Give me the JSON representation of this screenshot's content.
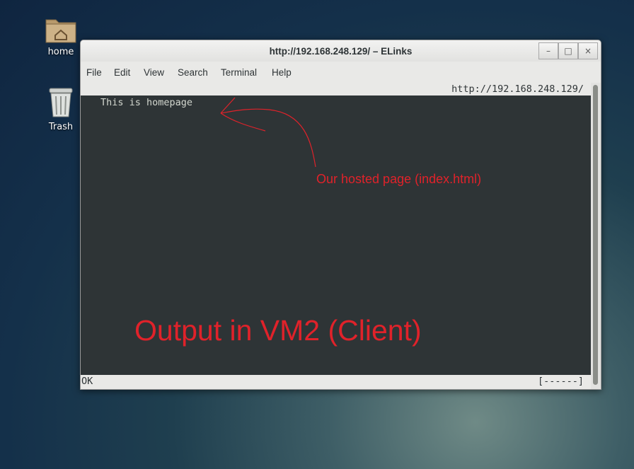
{
  "desktop": {
    "icons": [
      {
        "label": "home"
      },
      {
        "label": "Trash"
      }
    ]
  },
  "window": {
    "title": "http://192.168.248.129/ – ELinks",
    "controls": {
      "minimize": "–",
      "maximize": "□",
      "close": "×"
    },
    "menu": [
      "File",
      "Edit",
      "View",
      "Search",
      "Terminal",
      "Help"
    ]
  },
  "elinks": {
    "url": "http://192.168.248.129/",
    "page_text": "This is homepage",
    "status_left": "OK",
    "status_right": "[------]"
  },
  "annotations": {
    "pointer_note": "Our hosted page (index.html)",
    "caption": "Output in VM2 (Client)"
  },
  "colors": {
    "annotation_red": "#e0222a",
    "terminal_bg": "#2e3436",
    "terminal_fg": "#d3d7cf",
    "chrome_bg": "#e9e9e7"
  }
}
